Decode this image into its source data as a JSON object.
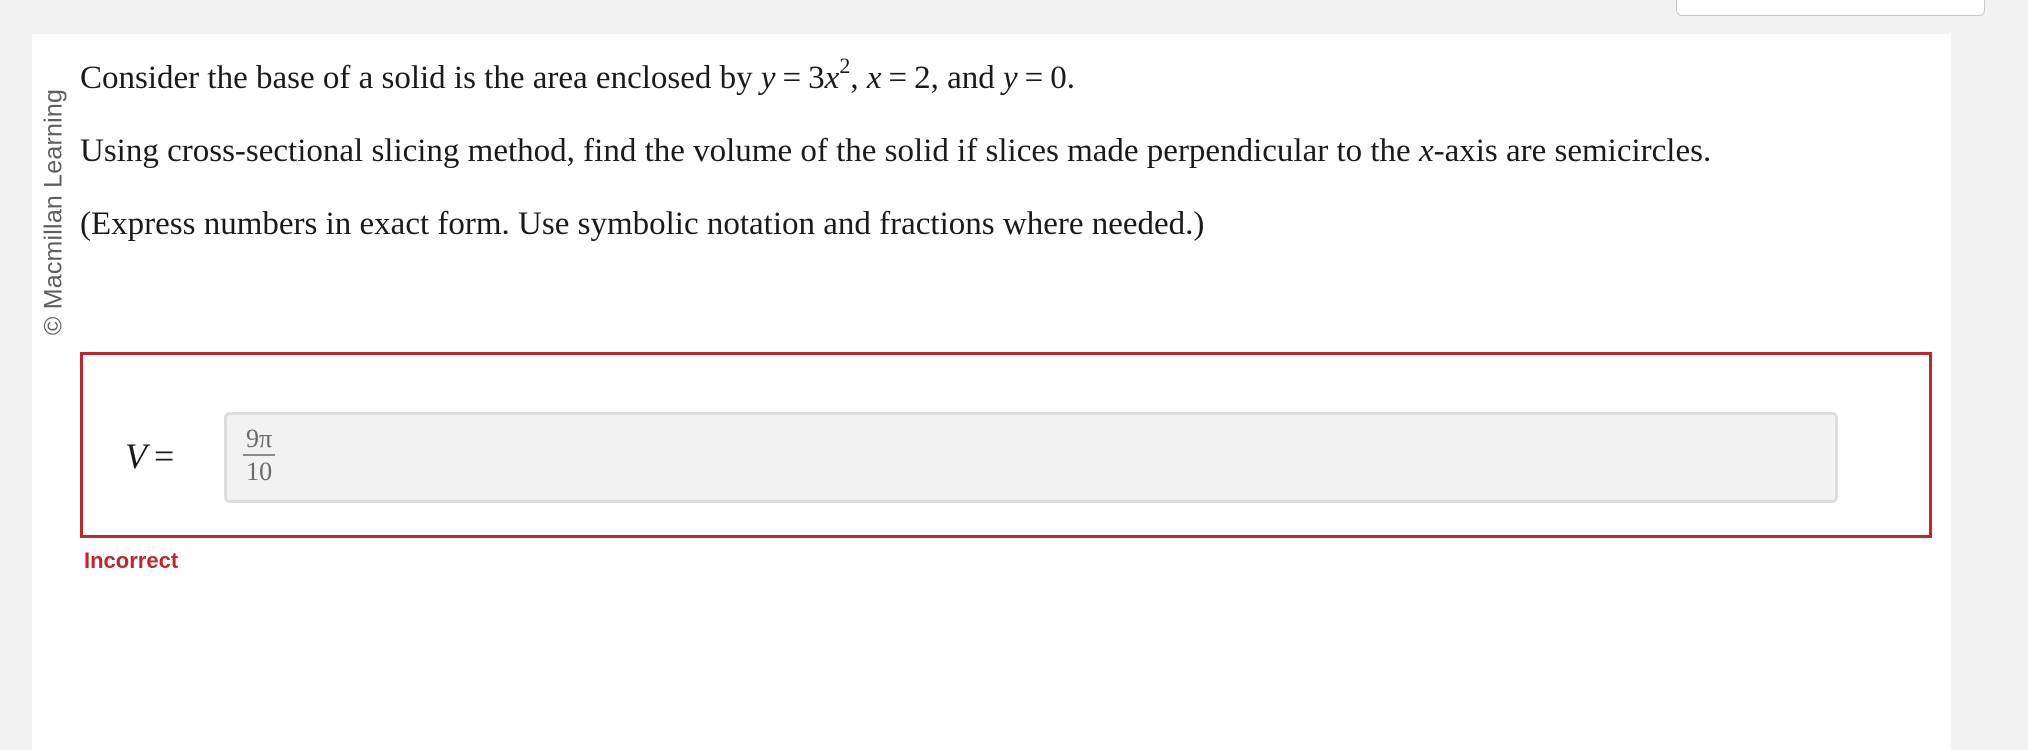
{
  "copyright": "© Macmillan Learning",
  "question": {
    "line1": {
      "prefix": "Consider the base of a solid is the area enclosed by ",
      "var_y1": "y",
      "eq1": "=",
      "coef": "3",
      "var_x1": "x",
      "exp": "2",
      "sep1": ",",
      "var_x2": "x",
      "eq2": "=",
      "val_x": "2",
      "and_text": ", and ",
      "var_y2": "y",
      "eq3": "=",
      "val_y": "0",
      "end": "."
    },
    "line2": {
      "before": "Using cross-sectional slicing method, find the volume of the solid if slices made perpendicular to the ",
      "axis_var": "x",
      "after": "-axis are semicircles."
    },
    "line3": "(Express numbers in exact form. Use symbolic notation and fractions where needed.)"
  },
  "answer": {
    "label_var": "V",
    "label_eq": "=",
    "numerator": "9π",
    "denominator": "10",
    "status": "Incorrect"
  },
  "colors": {
    "error_red": "#c0272d",
    "field_bg": "#f2f2f2",
    "page_bg": "#f2f2f2"
  }
}
